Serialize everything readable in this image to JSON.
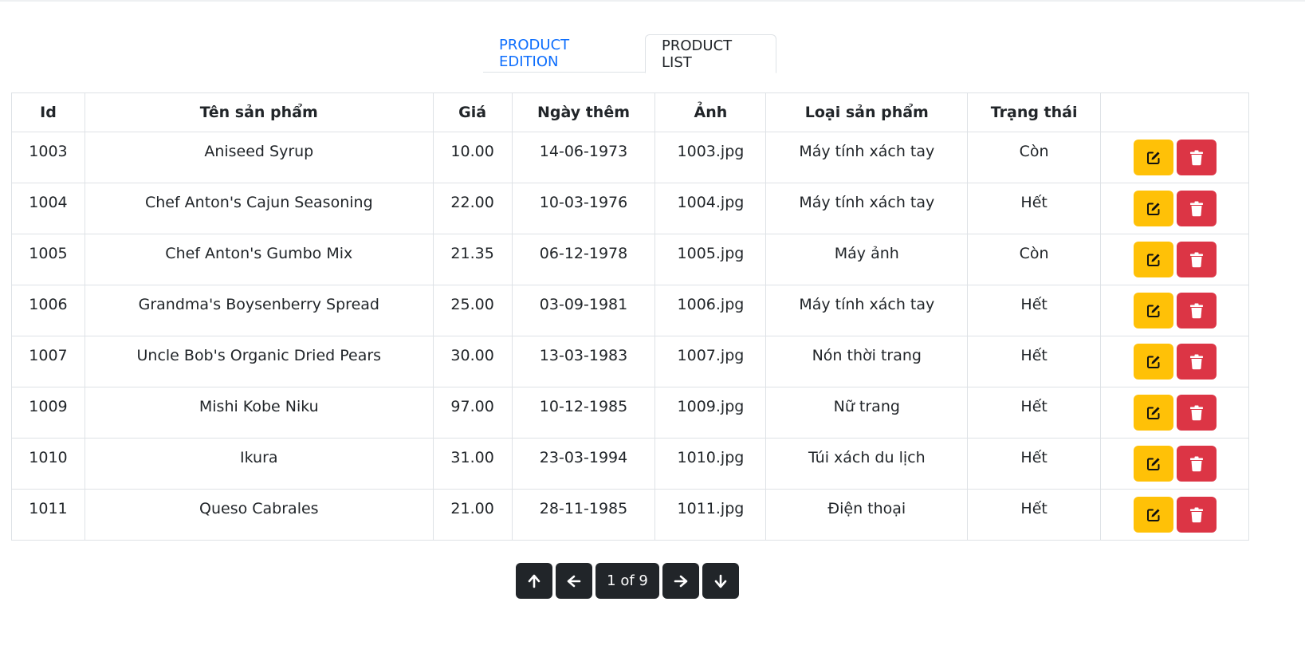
{
  "tabs": [
    {
      "label": "PRODUCT EDITION"
    },
    {
      "label": "PRODUCT LIST"
    }
  ],
  "table": {
    "headers": [
      "Id",
      "Tên sản phẩm",
      "Giá",
      "Ngày thêm",
      "Ảnh",
      "Loại sản phẩm",
      "Trạng thái",
      ""
    ],
    "rows": [
      {
        "id": "1003",
        "name": "Aniseed Syrup",
        "price": "10.00",
        "date": "14-06-1973",
        "image": "1003.jpg",
        "category": "Máy tính xách tay",
        "status": "Còn"
      },
      {
        "id": "1004",
        "name": "Chef Anton's Cajun Seasoning",
        "price": "22.00",
        "date": "10-03-1976",
        "image": "1004.jpg",
        "category": "Máy tính xách tay",
        "status": "Hết"
      },
      {
        "id": "1005",
        "name": "Chef Anton's Gumbo Mix",
        "price": "21.35",
        "date": "06-12-1978",
        "image": "1005.jpg",
        "category": "Máy ảnh",
        "status": "Còn"
      },
      {
        "id": "1006",
        "name": "Grandma's Boysenberry Spread",
        "price": "25.00",
        "date": "03-09-1981",
        "image": "1006.jpg",
        "category": "Máy tính xách tay",
        "status": "Hết"
      },
      {
        "id": "1007",
        "name": "Uncle Bob's Organic Dried Pears",
        "price": "30.00",
        "date": "13-03-1983",
        "image": "1007.jpg",
        "category": "Nón thời trang",
        "status": "Hết"
      },
      {
        "id": "1009",
        "name": "Mishi Kobe Niku",
        "price": "97.00",
        "date": "10-12-1985",
        "image": "1009.jpg",
        "category": "Nữ trang",
        "status": "Hết"
      },
      {
        "id": "1010",
        "name": "Ikura",
        "price": "31.00",
        "date": "23-03-1994",
        "image": "1010.jpg",
        "category": "Túi xách du lịch",
        "status": "Hết"
      },
      {
        "id": "1011",
        "name": "Queso Cabrales",
        "price": "21.00",
        "date": "28-11-1985",
        "image": "1011.jpg",
        "category": "Điện thoại",
        "status": "Hết"
      }
    ]
  },
  "pagination": {
    "label": "1 of 9"
  },
  "colors": {
    "accent": "#0d6efd",
    "edit": "#ffc107",
    "delete": "#dc3545",
    "dark": "#212529"
  }
}
